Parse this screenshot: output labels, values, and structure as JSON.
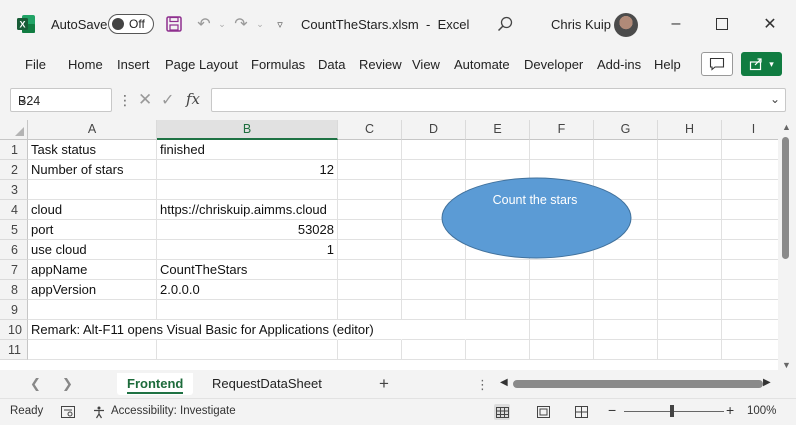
{
  "window": {
    "autosave_label": "AutoSave",
    "autosave_state": "Off",
    "filename": "CountTheStars.xlsm",
    "app_name": "Excel",
    "title_separator": "-",
    "user": "Chris Kuip"
  },
  "ribbon": {
    "tabs": [
      "File",
      "Home",
      "Insert",
      "Page Layout",
      "Formulas",
      "Data",
      "Review",
      "View",
      "Automate",
      "Developer",
      "Add-ins",
      "Help"
    ]
  },
  "formula_bar": {
    "name_box": "B24",
    "fx": "fx",
    "content": ""
  },
  "grid": {
    "columns": [
      "A",
      "B",
      "C",
      "D",
      "E",
      "F",
      "G",
      "H",
      "I"
    ],
    "selected_column": "B",
    "rows": [
      {
        "n": "1",
        "a": "Task status",
        "b": "finished"
      },
      {
        "n": "2",
        "a": "Number of stars",
        "b": "12"
      },
      {
        "n": "3",
        "a": "",
        "b": ""
      },
      {
        "n": "4",
        "a": "cloud",
        "b": "https://chriskuip.aimms.cloud"
      },
      {
        "n": "5",
        "a": "port",
        "b": "53028"
      },
      {
        "n": "6",
        "a": "use cloud",
        "b": "1"
      },
      {
        "n": "7",
        "a": "appName",
        "b": "CountTheStars"
      },
      {
        "n": "8",
        "a": "appVersion",
        "b": "2.0.0.0"
      },
      {
        "n": "9",
        "a": "",
        "b": ""
      },
      {
        "n": "10",
        "a": "Remark: Alt-F11 opens Visual Basic for Applications (editor)",
        "b": ""
      },
      {
        "n": "11",
        "a": "",
        "b": ""
      }
    ],
    "shape_button": {
      "label": "Count the stars",
      "fill": "#5b9bd5",
      "stroke": "#41719c"
    }
  },
  "sheets": {
    "tabs": [
      "Frontend",
      "RequestDataSheet"
    ],
    "active": "Frontend"
  },
  "status": {
    "ready": "Ready",
    "accessibility": "Accessibility: Investigate",
    "zoom": "100%"
  },
  "colors": {
    "excel_green": "#107c41",
    "selected_header_green": "#1f7244"
  }
}
